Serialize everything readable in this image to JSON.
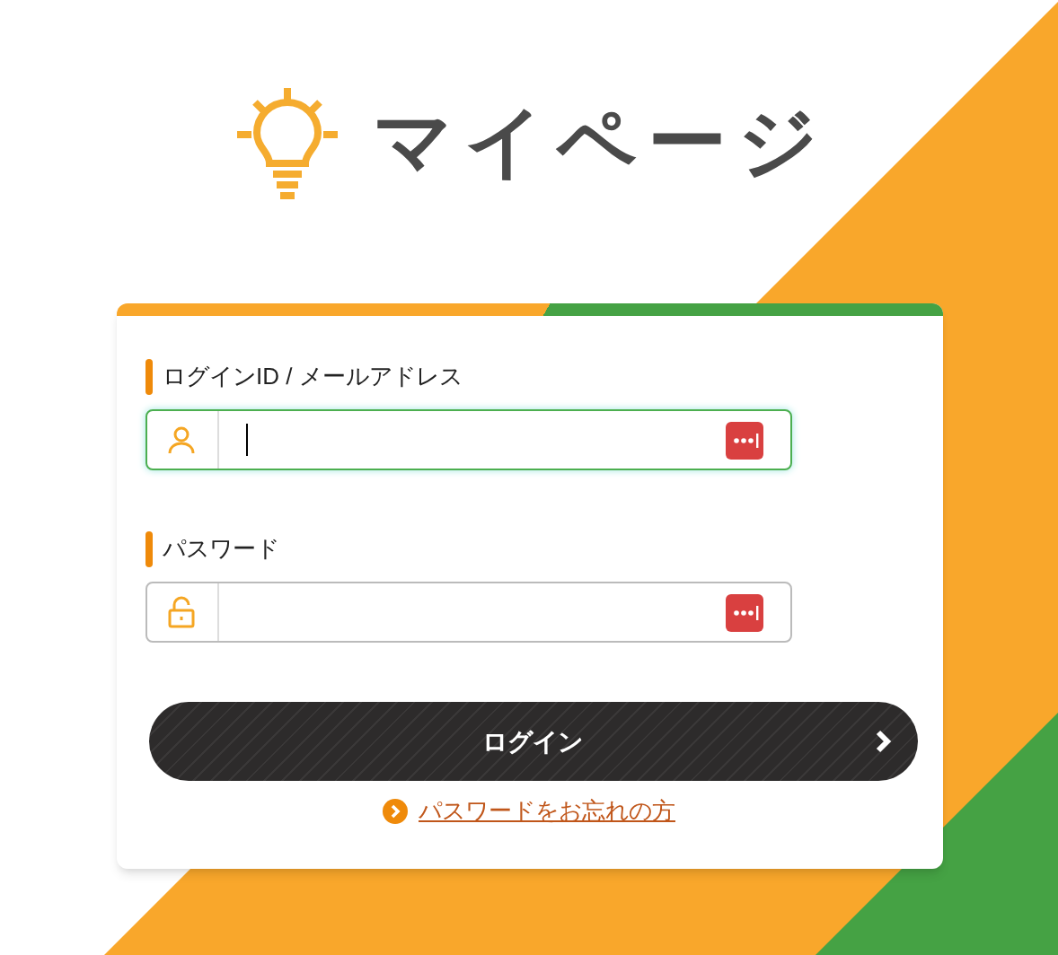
{
  "header": {
    "title": "マイページ"
  },
  "login_form": {
    "fields": [
      {
        "label": "ログインID / メールアドレス",
        "kind": "user",
        "focused": true
      },
      {
        "label": "パスワード",
        "kind": "password",
        "focused": false
      }
    ],
    "submit": "ログイン",
    "forgot_link": "パスワードをお忘れの方"
  }
}
